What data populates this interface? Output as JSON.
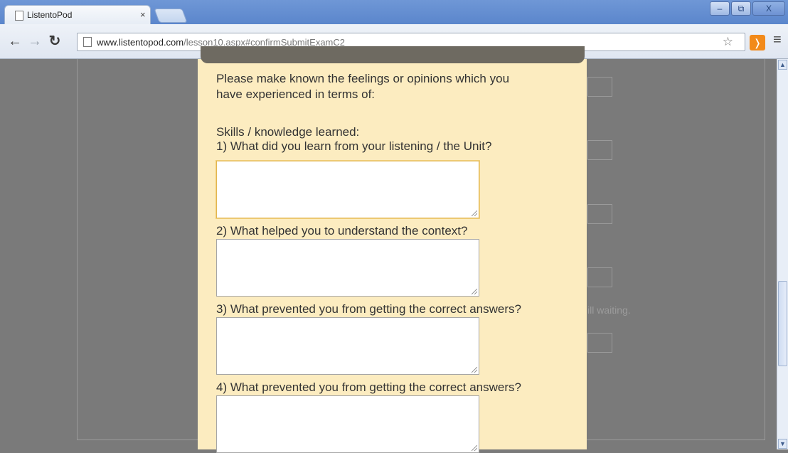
{
  "browser": {
    "tab_title": "ListentoPod",
    "tab_close": "×",
    "url_domain": "www.listentopod.com",
    "url_path": "/lesson10.aspx#confirmSubmitExamC2",
    "window_buttons": {
      "minimize": "–",
      "maximize": "⧉",
      "close": "X"
    }
  },
  "background_page": {
    "text_fragment": "ill waiting."
  },
  "modal": {
    "intro_line1": "Please make known the feelings or opinions which you",
    "intro_line2": "have experienced in terms of:",
    "section_label": "Skills / knowledge learned:",
    "questions": [
      "1) What did you learn from your listening / the Unit?",
      "2) What helped you to understand the context?",
      "3) What prevented you from getting the correct answers?",
      "4) What prevented you from getting the correct answers?"
    ]
  },
  "icons": [
    "page-icon",
    "back-icon",
    "forward-icon",
    "reload-icon",
    "star-icon",
    "rss-icon",
    "menu-icon"
  ],
  "colors": {
    "modal_bg": "#fcecc0",
    "overlay": "#7a7a7a",
    "focus_border": "#e2b54f",
    "title_bar": "#5b86cc"
  }
}
